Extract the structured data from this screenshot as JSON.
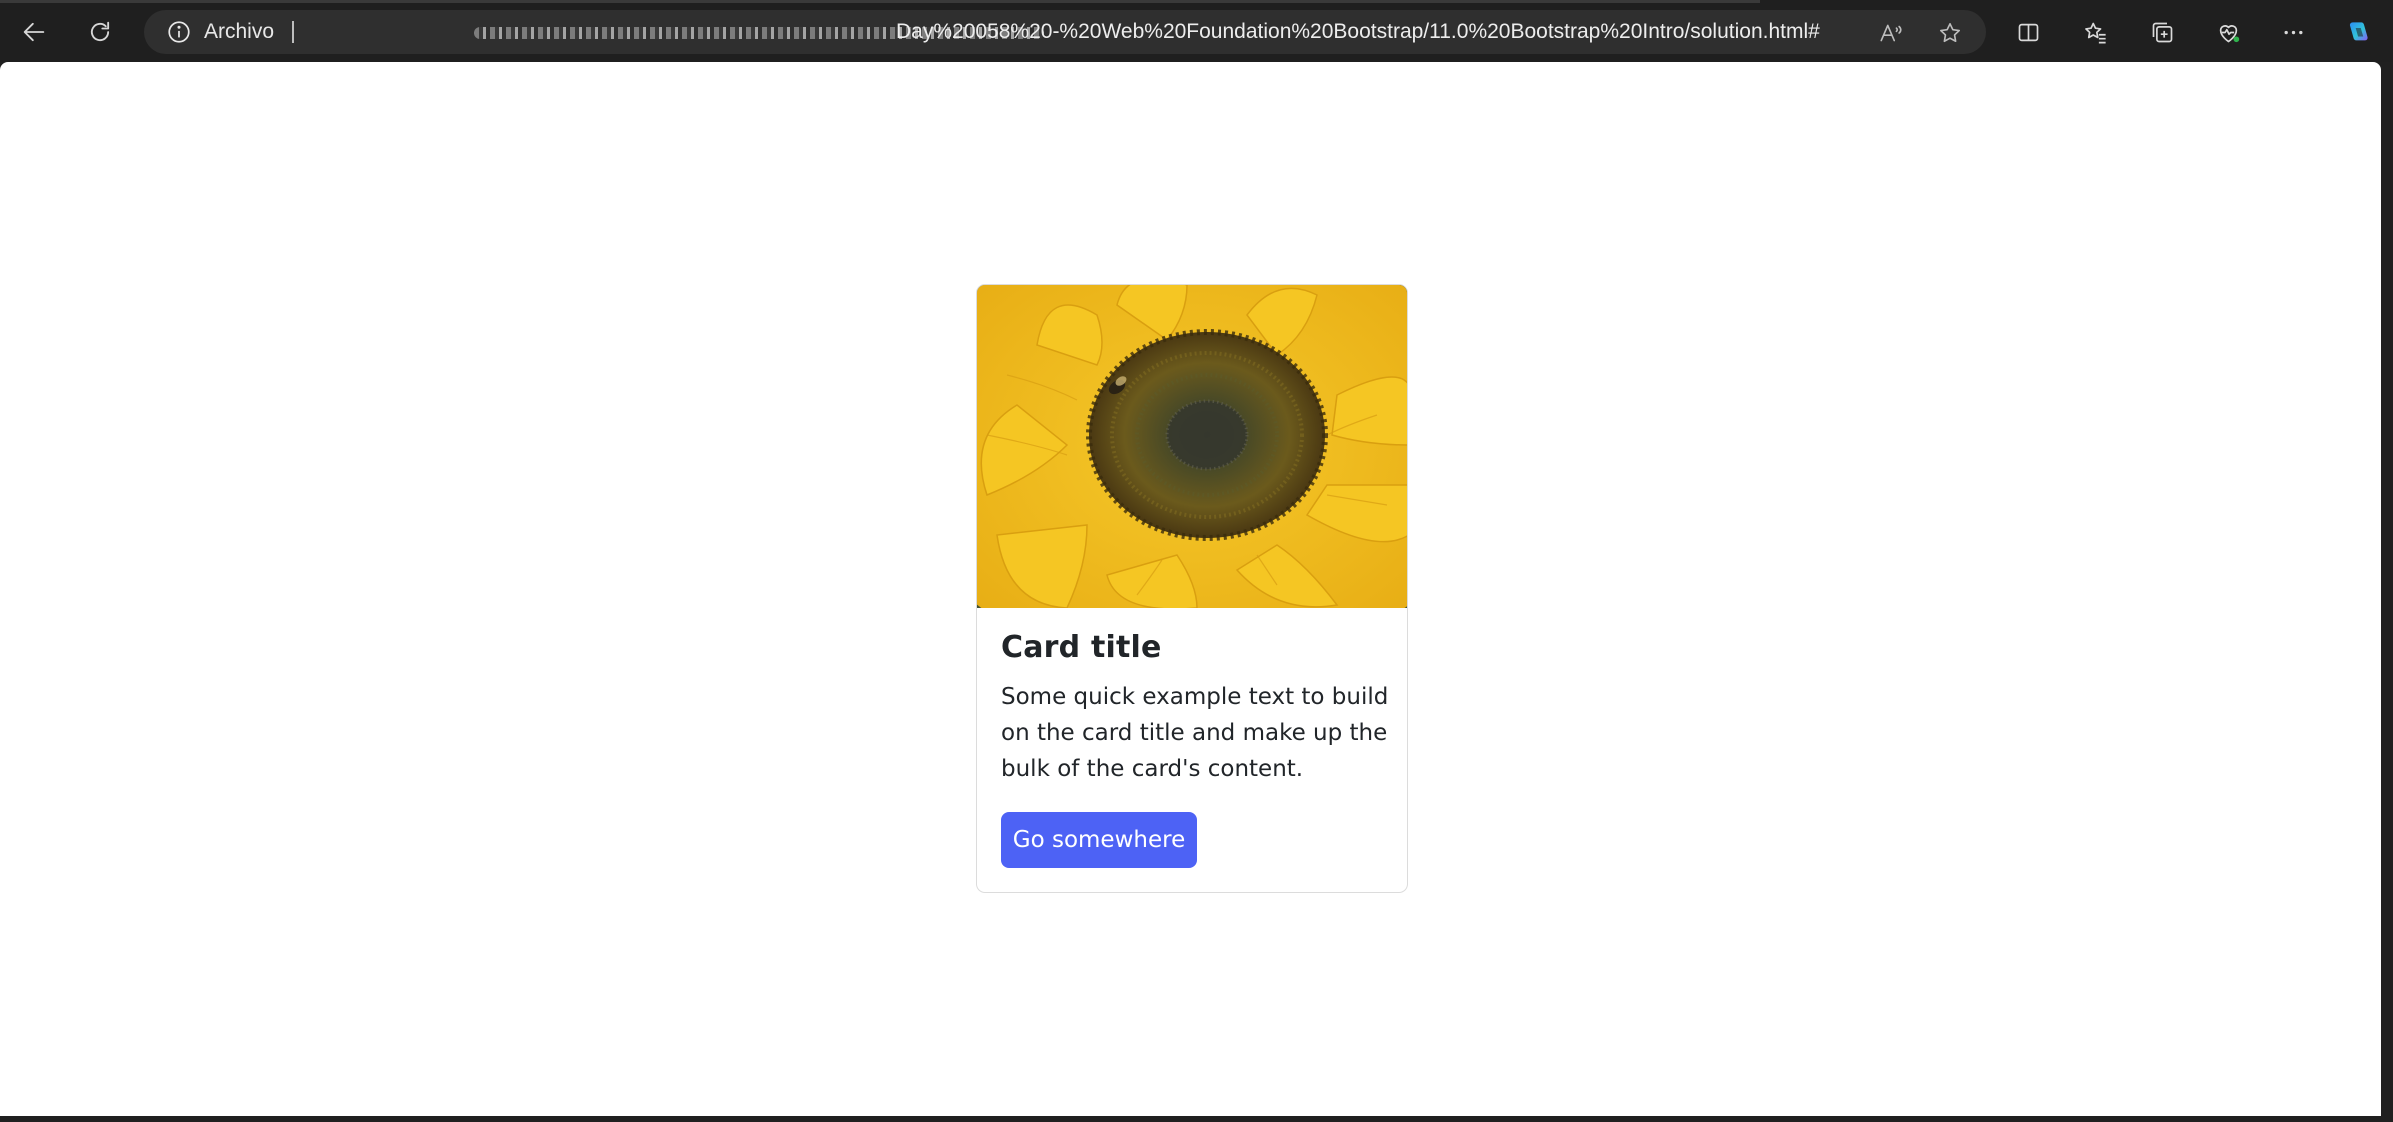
{
  "browser": {
    "site_info_label": "Archivo",
    "url_visible": "Day%20058%20-%20Web%20Foundation%20Bootstrap/11.0%20Bootstrap%20Intro/solution.html#",
    "icons": {
      "back": "back-arrow-icon",
      "reload": "reload-icon",
      "info": "info-icon",
      "read_aloud": "read-aloud-icon",
      "favorite": "star-icon",
      "split_screen": "split-screen-icon",
      "favorites": "favorites-icon",
      "collections": "collections-icon",
      "health": "browser-essentials-icon",
      "more": "more-icon",
      "copilot": "copilot-icon"
    }
  },
  "card": {
    "image_description": "sunflower-image",
    "title": "Card title",
    "text": "Some quick example text to build on the card title and make up the bulk of the card's content.",
    "button_label": "Go somewhere",
    "button_color": "#4d62f5"
  }
}
